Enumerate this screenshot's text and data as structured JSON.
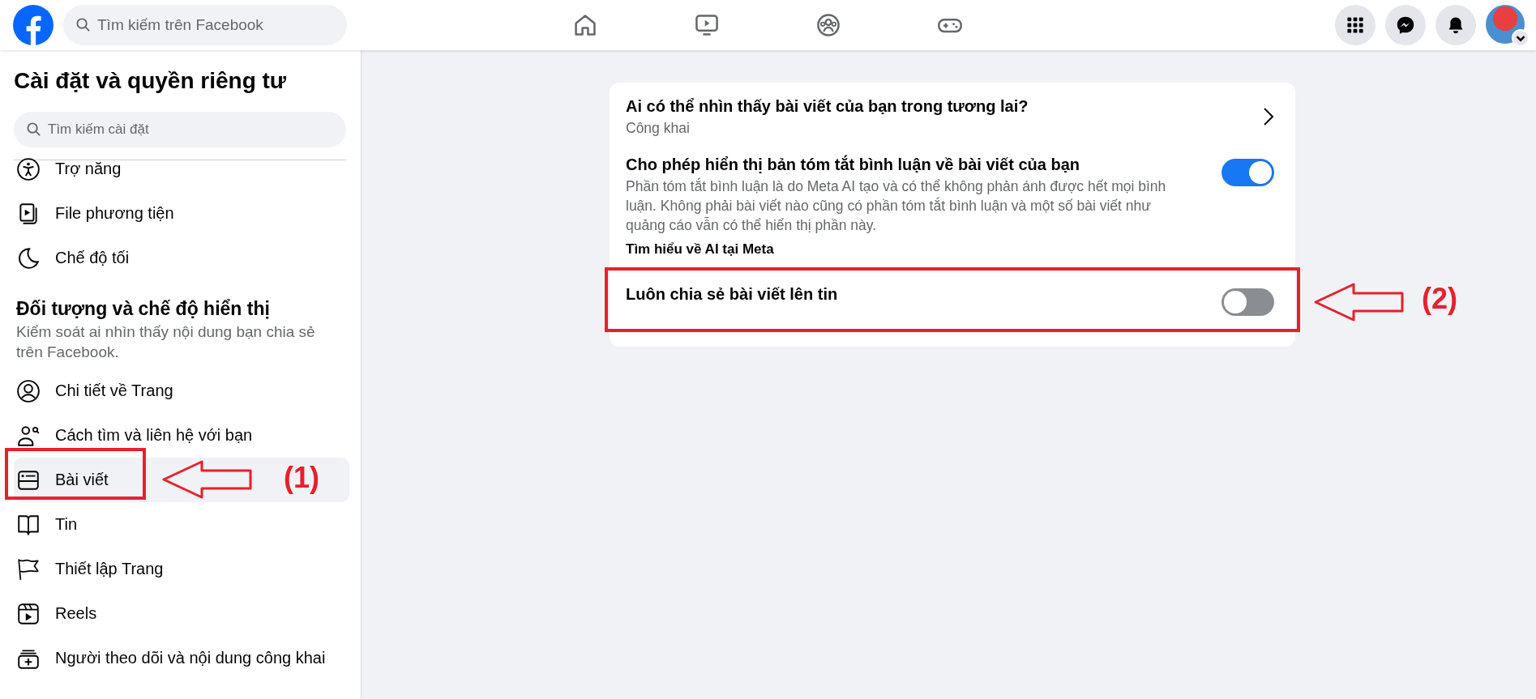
{
  "topbar": {
    "search": {
      "placeholder": "Tìm kiếm trên Facebook"
    }
  },
  "sidebar": {
    "title": "Cài đặt và quyền riêng tư",
    "search": {
      "placeholder": "Tìm kiếm cài đặt"
    },
    "items": [
      {
        "label": "Trợ năng",
        "selected": false
      },
      {
        "label": "File phương tiện",
        "selected": false
      },
      {
        "label": "Chế độ tối",
        "selected": false
      }
    ],
    "section": {
      "heading": "Đối tượng và chế độ hiển thị",
      "description": "Kiểm soát ai nhìn thấy nội dung bạn chia sẻ trên Facebook."
    },
    "section_items": [
      {
        "label": "Chi tiết về Trang",
        "selected": false
      },
      {
        "label": "Cách tìm và liên hệ với bạn",
        "selected": false
      },
      {
        "label": "Bài viết",
        "selected": true,
        "annotation": "(1)"
      },
      {
        "label": "Tin",
        "selected": false
      },
      {
        "label": "Thiết lập Trang",
        "selected": false
      },
      {
        "label": "Reels",
        "selected": false
      },
      {
        "label": "Người theo dõi và nội dung công khai",
        "selected": false
      }
    ]
  },
  "settings": [
    {
      "kind": "link",
      "title": "Ai có thể nhìn thấy bài viết của bạn trong tương lai?",
      "value": "Công khai"
    },
    {
      "kind": "toggle",
      "title": "Cho phép hiển thị bản tóm tắt bình luận về bài viết của bạn",
      "description": "Phần tóm tắt bình luận là do Meta AI tạo và có thể không phản ánh được hết mọi bình luận. Không phải bài viết nào cũng có phần tóm tắt bình luận và một số bài viết như quảng cáo vẫn có thể hiển thị phần này.",
      "link": "Tìm hiểu về AI tại Meta",
      "on": true
    },
    {
      "kind": "toggle",
      "title": "Luôn chia sẻ bài viết lên tin",
      "on": false,
      "annotation": "(2)"
    }
  ]
}
